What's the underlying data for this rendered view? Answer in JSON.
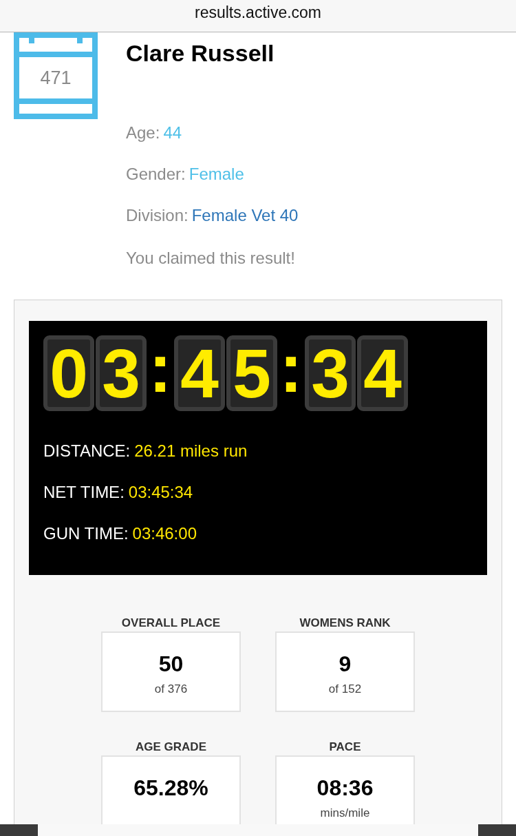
{
  "browser_bar": {
    "url": "results.active.com"
  },
  "athlete": {
    "bib_number": "471",
    "name": "Clare Russell",
    "details": [
      {
        "label": "Age:",
        "value": "44",
        "kind": "value"
      },
      {
        "label": "Gender:",
        "value": "Female",
        "kind": "value"
      },
      {
        "label": "Division:",
        "value": "Female Vet 40",
        "kind": "link"
      }
    ],
    "claim_note": "You claimed this result!"
  },
  "scoreboard": {
    "clock": "03:45:34",
    "lines": [
      {
        "label": "DISTANCE:",
        "value": "26.21 miles run"
      },
      {
        "label": "NET TIME:",
        "value": "03:45:34"
      },
      {
        "label": "GUN TIME:",
        "value": "03:46:00"
      }
    ]
  },
  "stats": [
    {
      "heading": "OVERALL PLACE",
      "value": "50",
      "sub": "of 376"
    },
    {
      "heading": "WOMENS RANK",
      "value": "9",
      "sub": "of 152"
    },
    {
      "heading": "AGE GRADE",
      "value": "65.28%"
    },
    {
      "heading": "PACE",
      "value": "08:36",
      "sub": "mins/mile"
    }
  ]
}
